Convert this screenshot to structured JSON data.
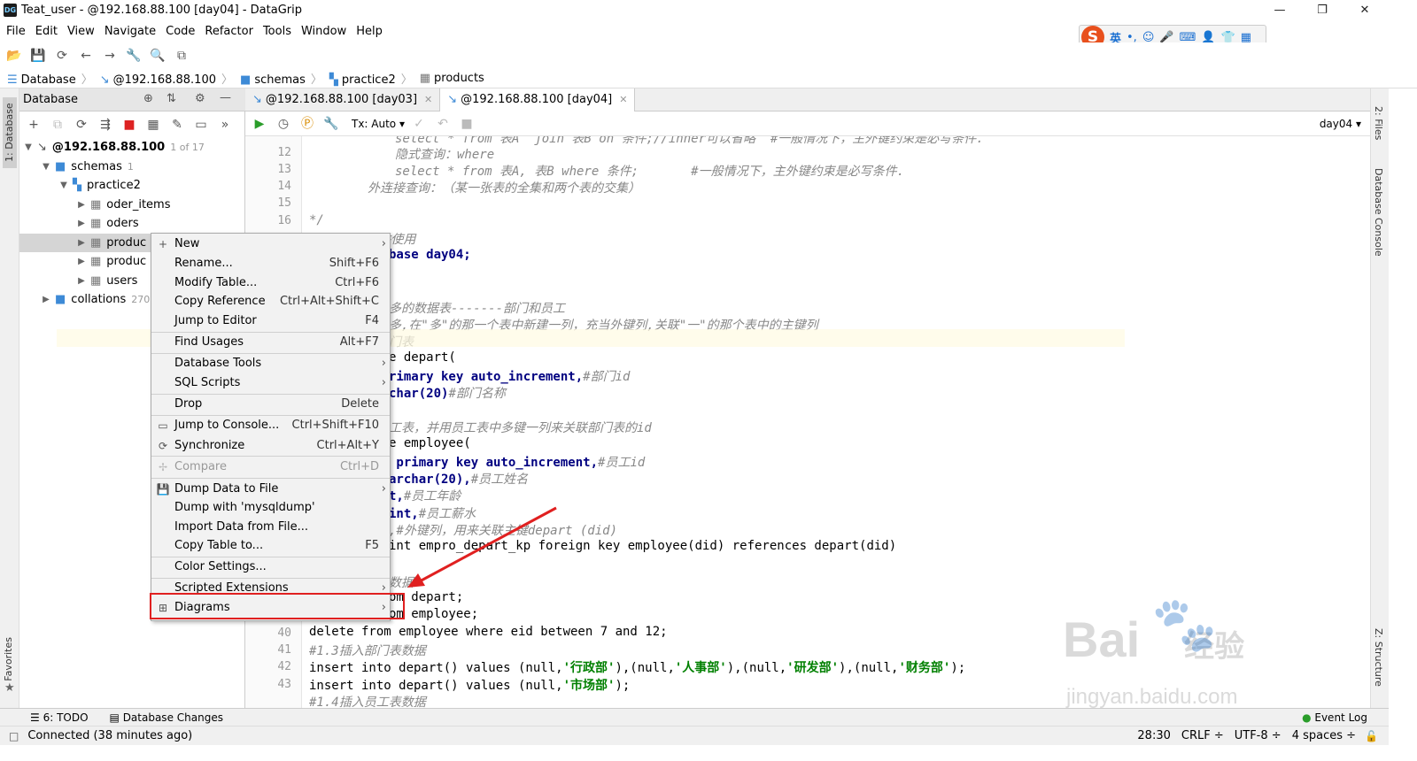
{
  "window": {
    "title": "Teat_user - @192.168.88.100 [day04] - DataGrip",
    "app_icon": "DG"
  },
  "menu": [
    "File",
    "Edit",
    "View",
    "Navigate",
    "Code",
    "Refactor",
    "Tools",
    "Window",
    "Help"
  ],
  "ime": {
    "logo": "S",
    "label": "英"
  },
  "breadcrumb": [
    "Database",
    "@192.168.88.100",
    "schemas",
    "practice2",
    "products"
  ],
  "db_panel": {
    "title": "Database",
    "tree": [
      {
        "label": "@192.168.88.100",
        "count": "1 of 17"
      },
      {
        "label": "schemas",
        "count": "1"
      },
      {
        "label": "practice2",
        "count": ""
      },
      {
        "label": "oder_items",
        "count": ""
      },
      {
        "label": "oders",
        "count": ""
      },
      {
        "label": "produc",
        "count": ""
      },
      {
        "label": "produc",
        "count": ""
      },
      {
        "label": "users",
        "count": ""
      },
      {
        "label": "collations",
        "count": "270"
      }
    ]
  },
  "tabs": [
    {
      "label": "@192.168.88.100 [day03]"
    },
    {
      "label": "@192.168.88.100 [day04]"
    }
  ],
  "editor_toolbar": {
    "tx": "Tx: Auto",
    "schema": "day04"
  },
  "gutter_lines": [
    "12",
    "13",
    "14",
    "15",
    "16",
    "40",
    "41",
    "42",
    "43"
  ],
  "code_lines": {
    "l11": "select * from 表A  join 表B on 条件;//inner可以省略  #一般情况下，主外键约束是必写条件.",
    "l12": "隐式查询：where",
    "l13": "select * from 表A, 表B where 条件;       #一般情况下，主外键约束是必写条件.",
    "l14": "外连接查询：（某一张表的全集和两个表的交集）",
    "l16": "*/",
    "c1": "#创建数据库并使用",
    "c2": "base day04;",
    "c3": "多的数据表-------部门和员工",
    "c4": "多,在\"多\"的那一个表中新建一列，充当外键列,关联\"一\"的那个表中的主键列",
    "c5": "门表",
    "c6": "e depart(",
    "c7a": "rimary key auto_increment,",
    "c7b": "#部门id",
    "c8a": "char(20)",
    "c8b": "#部门名称",
    "c9": "工表，并用员工表中多键一列来关联部门表的id",
    "c10": "e employee(",
    "c11a": " primary key auto_increment,",
    "c11b": "#员工id",
    "c12a": "archar(20),",
    "c12b": "#员工姓名",
    "c13a": "t,",
    "c13b": "#员工年龄",
    "c14a": "int,",
    "c14b": "#员工薪水",
    "c15": ",#外键列，用来关联主键depart (did)",
    "c16": "int empro_depart_kp foreign key employee(did) references depart(did)",
    "c17": "数据",
    "c18": "om depart;",
    "c19": "om employee;",
    "l40": "delete from employee where eid between 7 and 12;",
    "l41": "#1.3插入部门表数据",
    "l42a": "insert into depart() values (null,",
    "l42b": "'行政部'",
    "l42c": "),(null,",
    "l42d": "'人事部'",
    "l42e": "),(null,",
    "l42f": "'研发部'",
    "l42g": "),(null,",
    "l42h": "'财务部'",
    "l42i": ");",
    "l43a": "insert into depart() values (null,",
    "l43b": "'市场部'",
    "l43c": ");",
    "l44": "#1.4插入员工表数据"
  },
  "context_menu": [
    {
      "label": "New",
      "shortcut": "",
      "submenu": true
    },
    {
      "label": "Rename...",
      "shortcut": "Shift+F6"
    },
    {
      "label": "Modify Table...",
      "shortcut": "Ctrl+F6"
    },
    {
      "label": "Copy Reference",
      "shortcut": "Ctrl+Alt+Shift+C"
    },
    {
      "label": "Jump to Editor",
      "shortcut": "F4"
    },
    {
      "label": "Find Usages",
      "shortcut": "Alt+F7"
    },
    {
      "label": "Database Tools",
      "shortcut": "",
      "submenu": true
    },
    {
      "label": "SQL Scripts",
      "shortcut": "",
      "submenu": true
    },
    {
      "label": "Drop",
      "shortcut": "Delete"
    },
    {
      "label": "Jump to Console...",
      "shortcut": "Ctrl+Shift+F10"
    },
    {
      "label": "Synchronize",
      "shortcut": "Ctrl+Alt+Y"
    },
    {
      "label": "Compare",
      "shortcut": "Ctrl+D",
      "disabled": true
    },
    {
      "label": "Dump Data to File",
      "shortcut": "",
      "submenu": true
    },
    {
      "label": "Dump with 'mysqldump'",
      "shortcut": ""
    },
    {
      "label": "Import Data from File...",
      "shortcut": ""
    },
    {
      "label": "Copy Table to...",
      "shortcut": "F5"
    },
    {
      "label": "Color Settings...",
      "shortcut": ""
    },
    {
      "label": "Scripted Extensions",
      "shortcut": "",
      "submenu": true
    },
    {
      "label": "Diagrams",
      "shortcut": "",
      "submenu": true
    }
  ],
  "right_strip": [
    "2: Files",
    "Database Console",
    "Z: Structure"
  ],
  "left_strip": [
    "1: Database",
    "Favorites"
  ],
  "bottom_tabs": {
    "todo": "6: TODO",
    "changes": "Database Changes",
    "event_log": "Event Log"
  },
  "status": {
    "message": "Connected (38 minutes ago)",
    "position": "28:30",
    "line_sep": "CRLF",
    "encoding": "UTF-8",
    "indent": "4 spaces"
  },
  "watermark": {
    "brand": "Bai",
    "brand2": "经验",
    "url": "jingyan.baidu.com"
  },
  "colors": {
    "highlight_box": "#e02020",
    "accent": "#3d8ad6"
  }
}
